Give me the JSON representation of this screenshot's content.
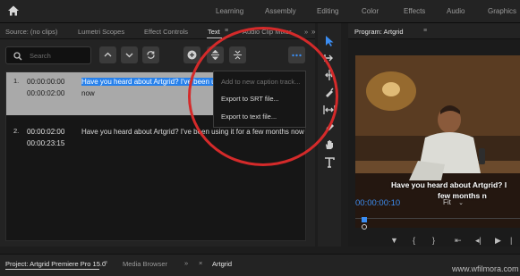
{
  "workspaces": [
    "Learning",
    "Assembly",
    "Editing",
    "Color",
    "Effects",
    "Audio",
    "Graphics"
  ],
  "left_panel_tabs": {
    "source": "Source: (no clips)",
    "scopes": "Lumetri Scopes",
    "effect_controls": "Effect Controls",
    "text": "Text",
    "audio_clip_mixer": "Audio Clip Mixer"
  },
  "program_title": "Program: Artgrid",
  "search": {
    "placeholder": "Search"
  },
  "captions": [
    {
      "index": "1.",
      "start": "00:00:00:00",
      "end": "00:00:02:00",
      "text_selected": "Have you heard about Artgrid? I've been us",
      "text_rest": "now"
    },
    {
      "index": "2.",
      "start": "00:00:02:00",
      "end": "00:00:23:15",
      "text": "Have you heard about Artgrid? I've been using it for a few months now"
    }
  ],
  "context_menu": {
    "items": [
      {
        "label": "Add to new caption track...",
        "enabled": false
      },
      {
        "label": "Export to SRT file...",
        "enabled": true
      },
      {
        "label": "Export to text file...",
        "enabled": true
      }
    ]
  },
  "program": {
    "caption_line1": "Have you heard about Artgrid? I",
    "caption_line2": "few months n",
    "timecode": "00:00:00:10",
    "zoom": "Fit"
  },
  "bottom": {
    "project_tab": "Project: Artgrid Premiere Pro 15.0",
    "media_browser": "Media Browser",
    "sequence": "Artgrid"
  },
  "watermark": "www.wfilmora.com",
  "colors": {
    "accent": "#2680eb",
    "annotation": "#d42a2a",
    "timecode": "#3c8df0",
    "tool_selected": "#3b8df2"
  }
}
